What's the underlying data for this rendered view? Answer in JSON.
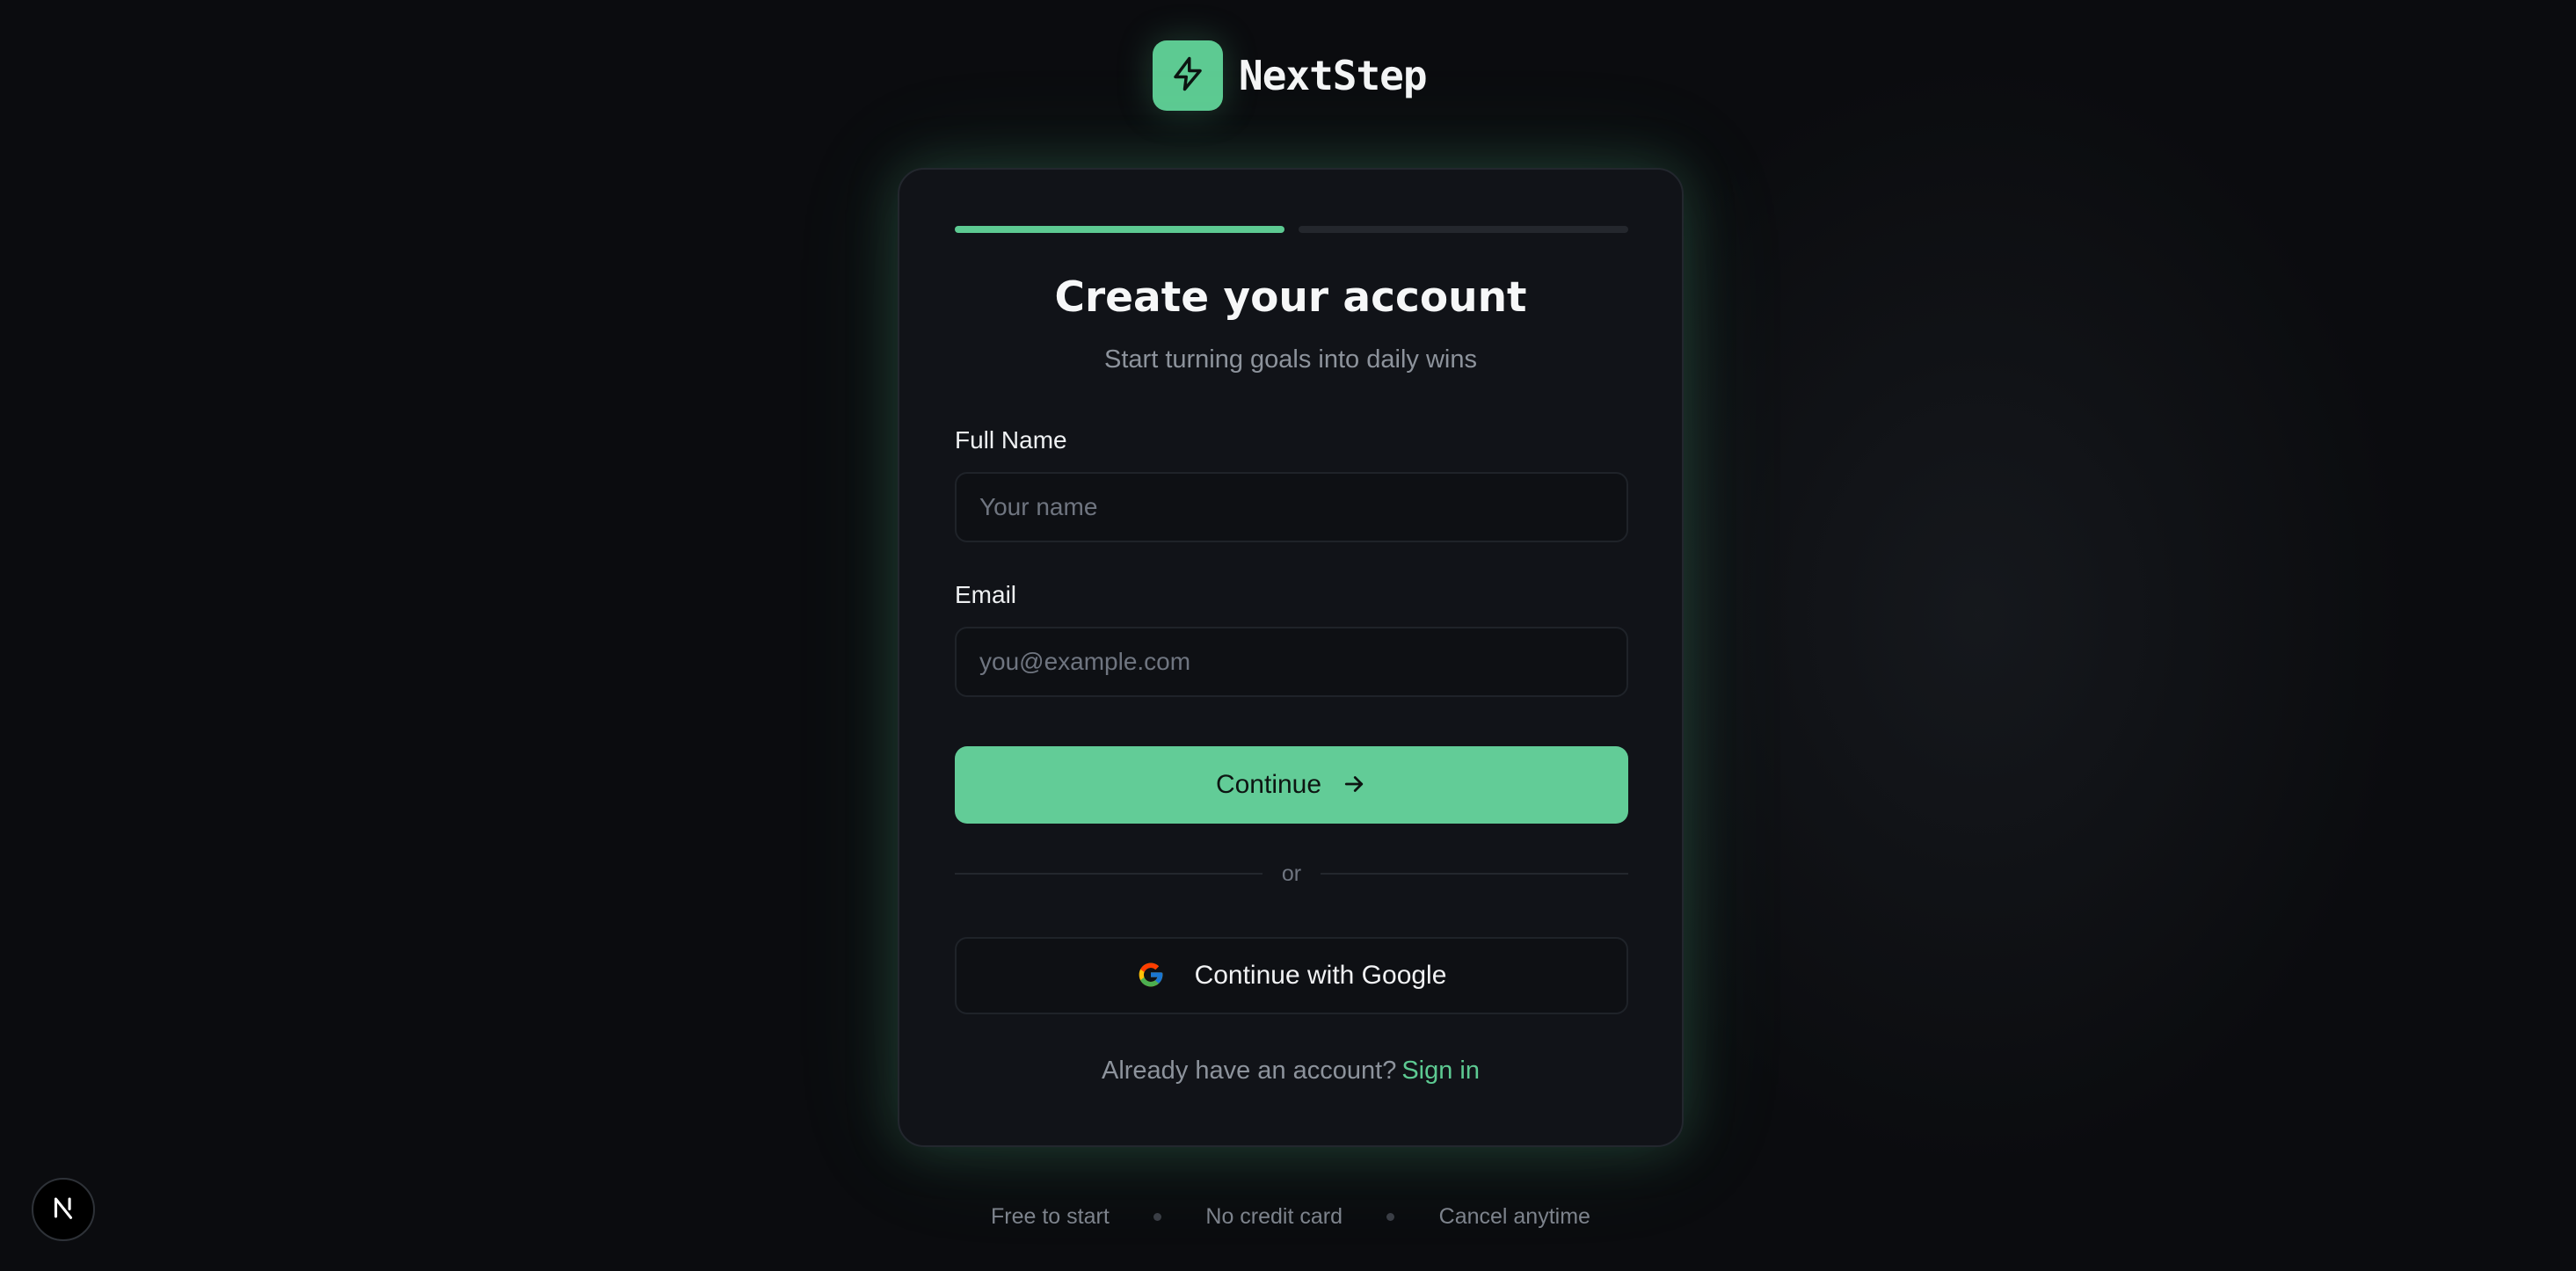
{
  "brand": {
    "name": "NextStep",
    "logo_icon": "lightning-bolt-icon",
    "accent_color": "#5dca92"
  },
  "progress": {
    "current_step": 1,
    "total_steps": 2
  },
  "form": {
    "title": "Create your account",
    "subtitle": "Start turning goals into daily wins",
    "full_name": {
      "label": "Full Name",
      "value": "",
      "placeholder": "Your name"
    },
    "email": {
      "label": "Email",
      "value": "",
      "placeholder": "you@example.com"
    },
    "continue_label": "Continue",
    "continue_icon": "arrow-right-icon",
    "divider_text": "or",
    "google_label": "Continue with Google",
    "google_icon": "google-icon",
    "signin_prompt": "Already have an account?",
    "signin_link": "Sign in"
  },
  "footer": {
    "items": [
      "Free to start",
      "No credit card",
      "Cancel anytime"
    ]
  },
  "corner_badge": {
    "icon": "next-logo-icon"
  }
}
